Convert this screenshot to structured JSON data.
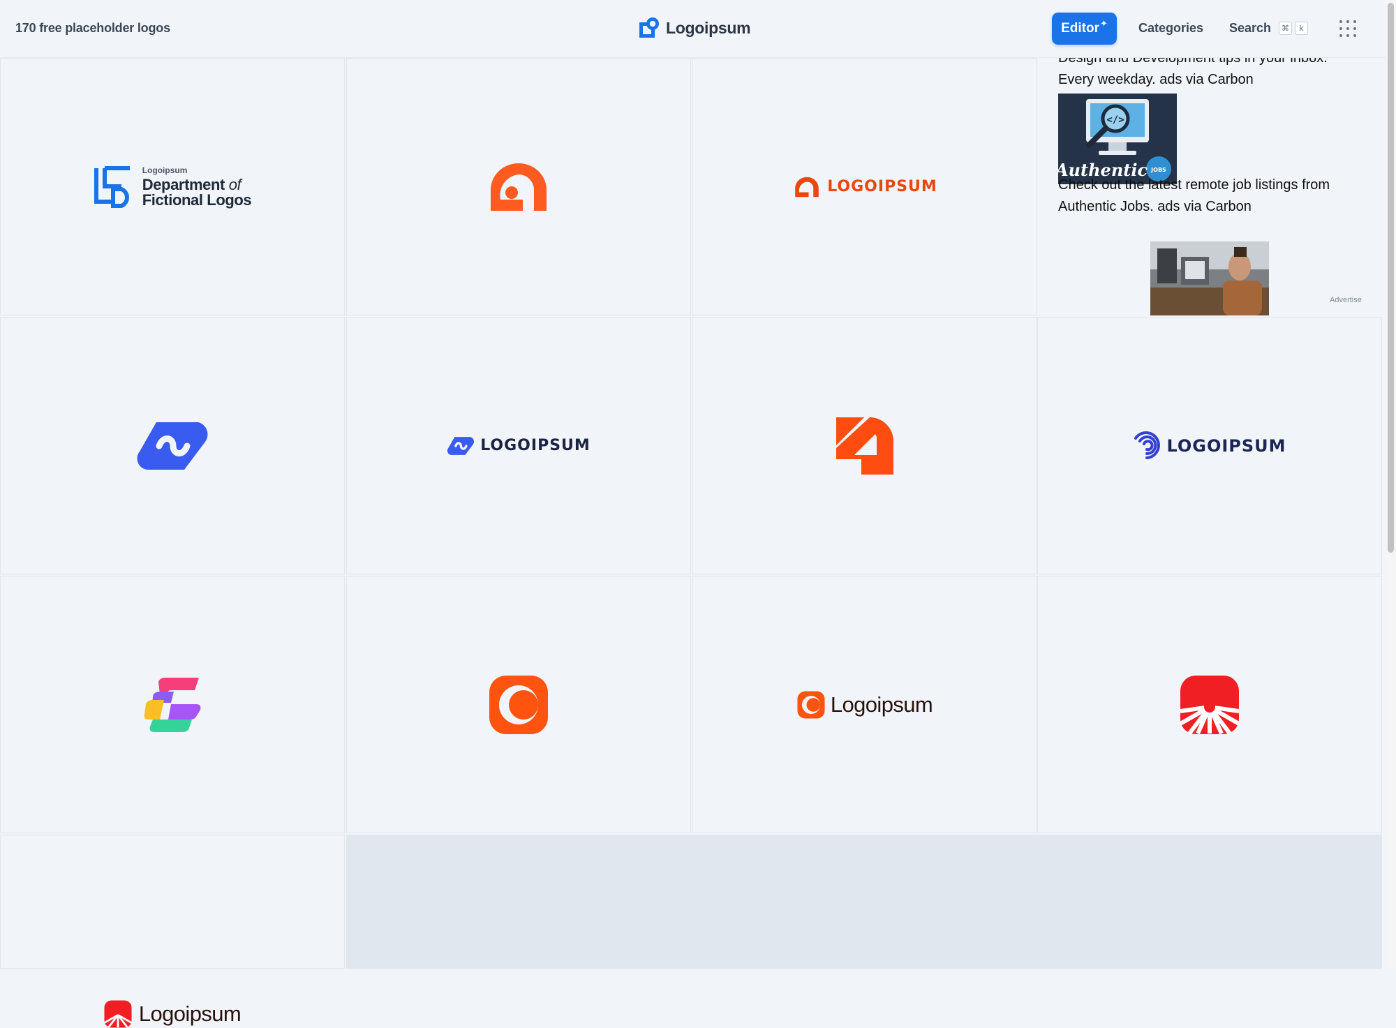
{
  "header": {
    "logo_count_text": "170 free placeholder logos",
    "brand_name": "Logoipsum",
    "editor_label": "Editor",
    "categories_label": "Categories",
    "search_label": "Search",
    "search_shortcut_cmd": "⌘",
    "search_shortcut_key": "k"
  },
  "logos": [
    {
      "kind": "department",
      "small": "Logoipsum",
      "line1": "Department",
      "line1_italic": "of",
      "line2": "Fictional Logos",
      "color": "#1a73e8"
    },
    {
      "kind": "arch-mark",
      "color": "#ff5a1f"
    },
    {
      "kind": "arch-wordmark",
      "text": "LOGOIPSUM",
      "color": "#e8470e"
    },
    {
      "kind": "ad"
    },
    {
      "kind": "loop-mark",
      "color": "#3a5bef"
    },
    {
      "kind": "loop-wordmark",
      "text": "LOGOIPSUM",
      "color": "#1c2340"
    },
    {
      "kind": "d-mark",
      "color": "#ff4d12"
    },
    {
      "kind": "spiral-wordmark",
      "text": "LOGOIPSUM",
      "color": "#1c2654"
    },
    {
      "kind": "s-mark"
    },
    {
      "kind": "ring-mark",
      "color": "#ff5410"
    },
    {
      "kind": "ring-wordmark",
      "text": "Logoipsum",
      "color": "#ff5410"
    },
    {
      "kind": "sun-mark",
      "color": "#ef1f24"
    },
    {
      "kind": "sun-wordmark",
      "text": "Logoipsum",
      "color": "#ef1f24"
    }
  ],
  "ad": {
    "text1": "Design and Development tips in your inbox. Every weekday. ads via Carbon",
    "image1_caption": "Authentic",
    "image1_badge": "JOBS",
    "text2": "Check out the latest remote job listings from Authentic Jobs. ads via Carbon",
    "advertise_label": "Advertise"
  }
}
